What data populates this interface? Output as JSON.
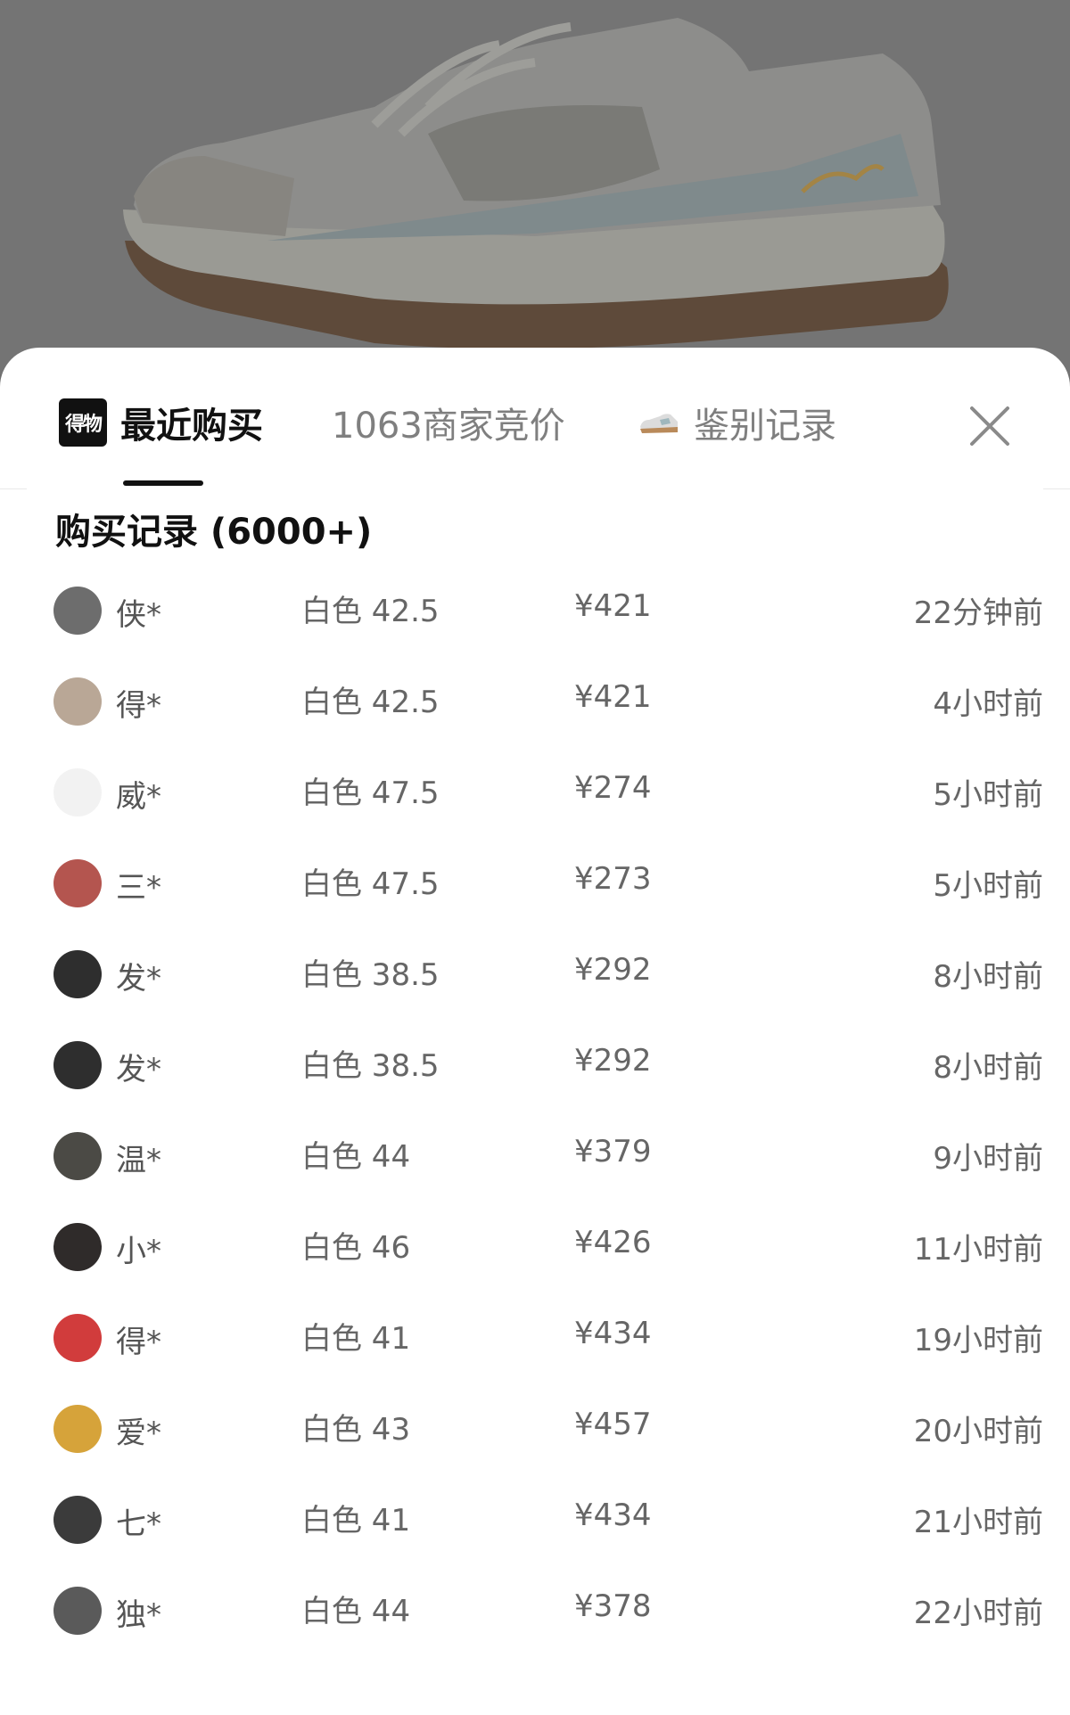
{
  "tabs": {
    "logo_text": "得物",
    "recent": "最近购买",
    "sellers": "1063商家竞价",
    "appraisal": "鉴别记录"
  },
  "list": {
    "title": "购买记录 (6000+)",
    "rows": [
      {
        "user": "侠*",
        "spec": "白色 42.5",
        "price": "¥421",
        "time": "22分钟前",
        "avatar_color": "#6d6d6d"
      },
      {
        "user": "得*",
        "spec": "白色 42.5",
        "price": "¥421",
        "time": "4小时前",
        "avatar_color": "#b9a796"
      },
      {
        "user": "威*",
        "spec": "白色 47.5",
        "price": "¥274",
        "time": "5小时前",
        "avatar_color": "#f2f2f2"
      },
      {
        "user": "三*",
        "spec": "白色 47.5",
        "price": "¥273",
        "time": "5小时前",
        "avatar_color": "#b4554f"
      },
      {
        "user": "发*",
        "spec": "白色 38.5",
        "price": "¥292",
        "time": "8小时前",
        "avatar_color": "#2e2e2e"
      },
      {
        "user": "发*",
        "spec": "白色 38.5",
        "price": "¥292",
        "time": "8小时前",
        "avatar_color": "#2e2e2e"
      },
      {
        "user": "温*",
        "spec": "白色 44",
        "price": "¥379",
        "time": "9小时前",
        "avatar_color": "#4b4a45"
      },
      {
        "user": "小*",
        "spec": "白色 46",
        "price": "¥426",
        "time": "11小时前",
        "avatar_color": "#2f2b2a"
      },
      {
        "user": "得*",
        "spec": "白色 41",
        "price": "¥434",
        "time": "19小时前",
        "avatar_color": "#d13c3c"
      },
      {
        "user": "爱*",
        "spec": "白色 43",
        "price": "¥457",
        "time": "20小时前",
        "avatar_color": "#d6a33a"
      },
      {
        "user": "七*",
        "spec": "白色 41",
        "price": "¥434",
        "time": "21小时前",
        "avatar_color": "#3b3b3b"
      },
      {
        "user": "独*",
        "spec": "白色 44",
        "price": "¥378",
        "time": "22小时前",
        "avatar_color": "#5a5a5a"
      }
    ]
  }
}
